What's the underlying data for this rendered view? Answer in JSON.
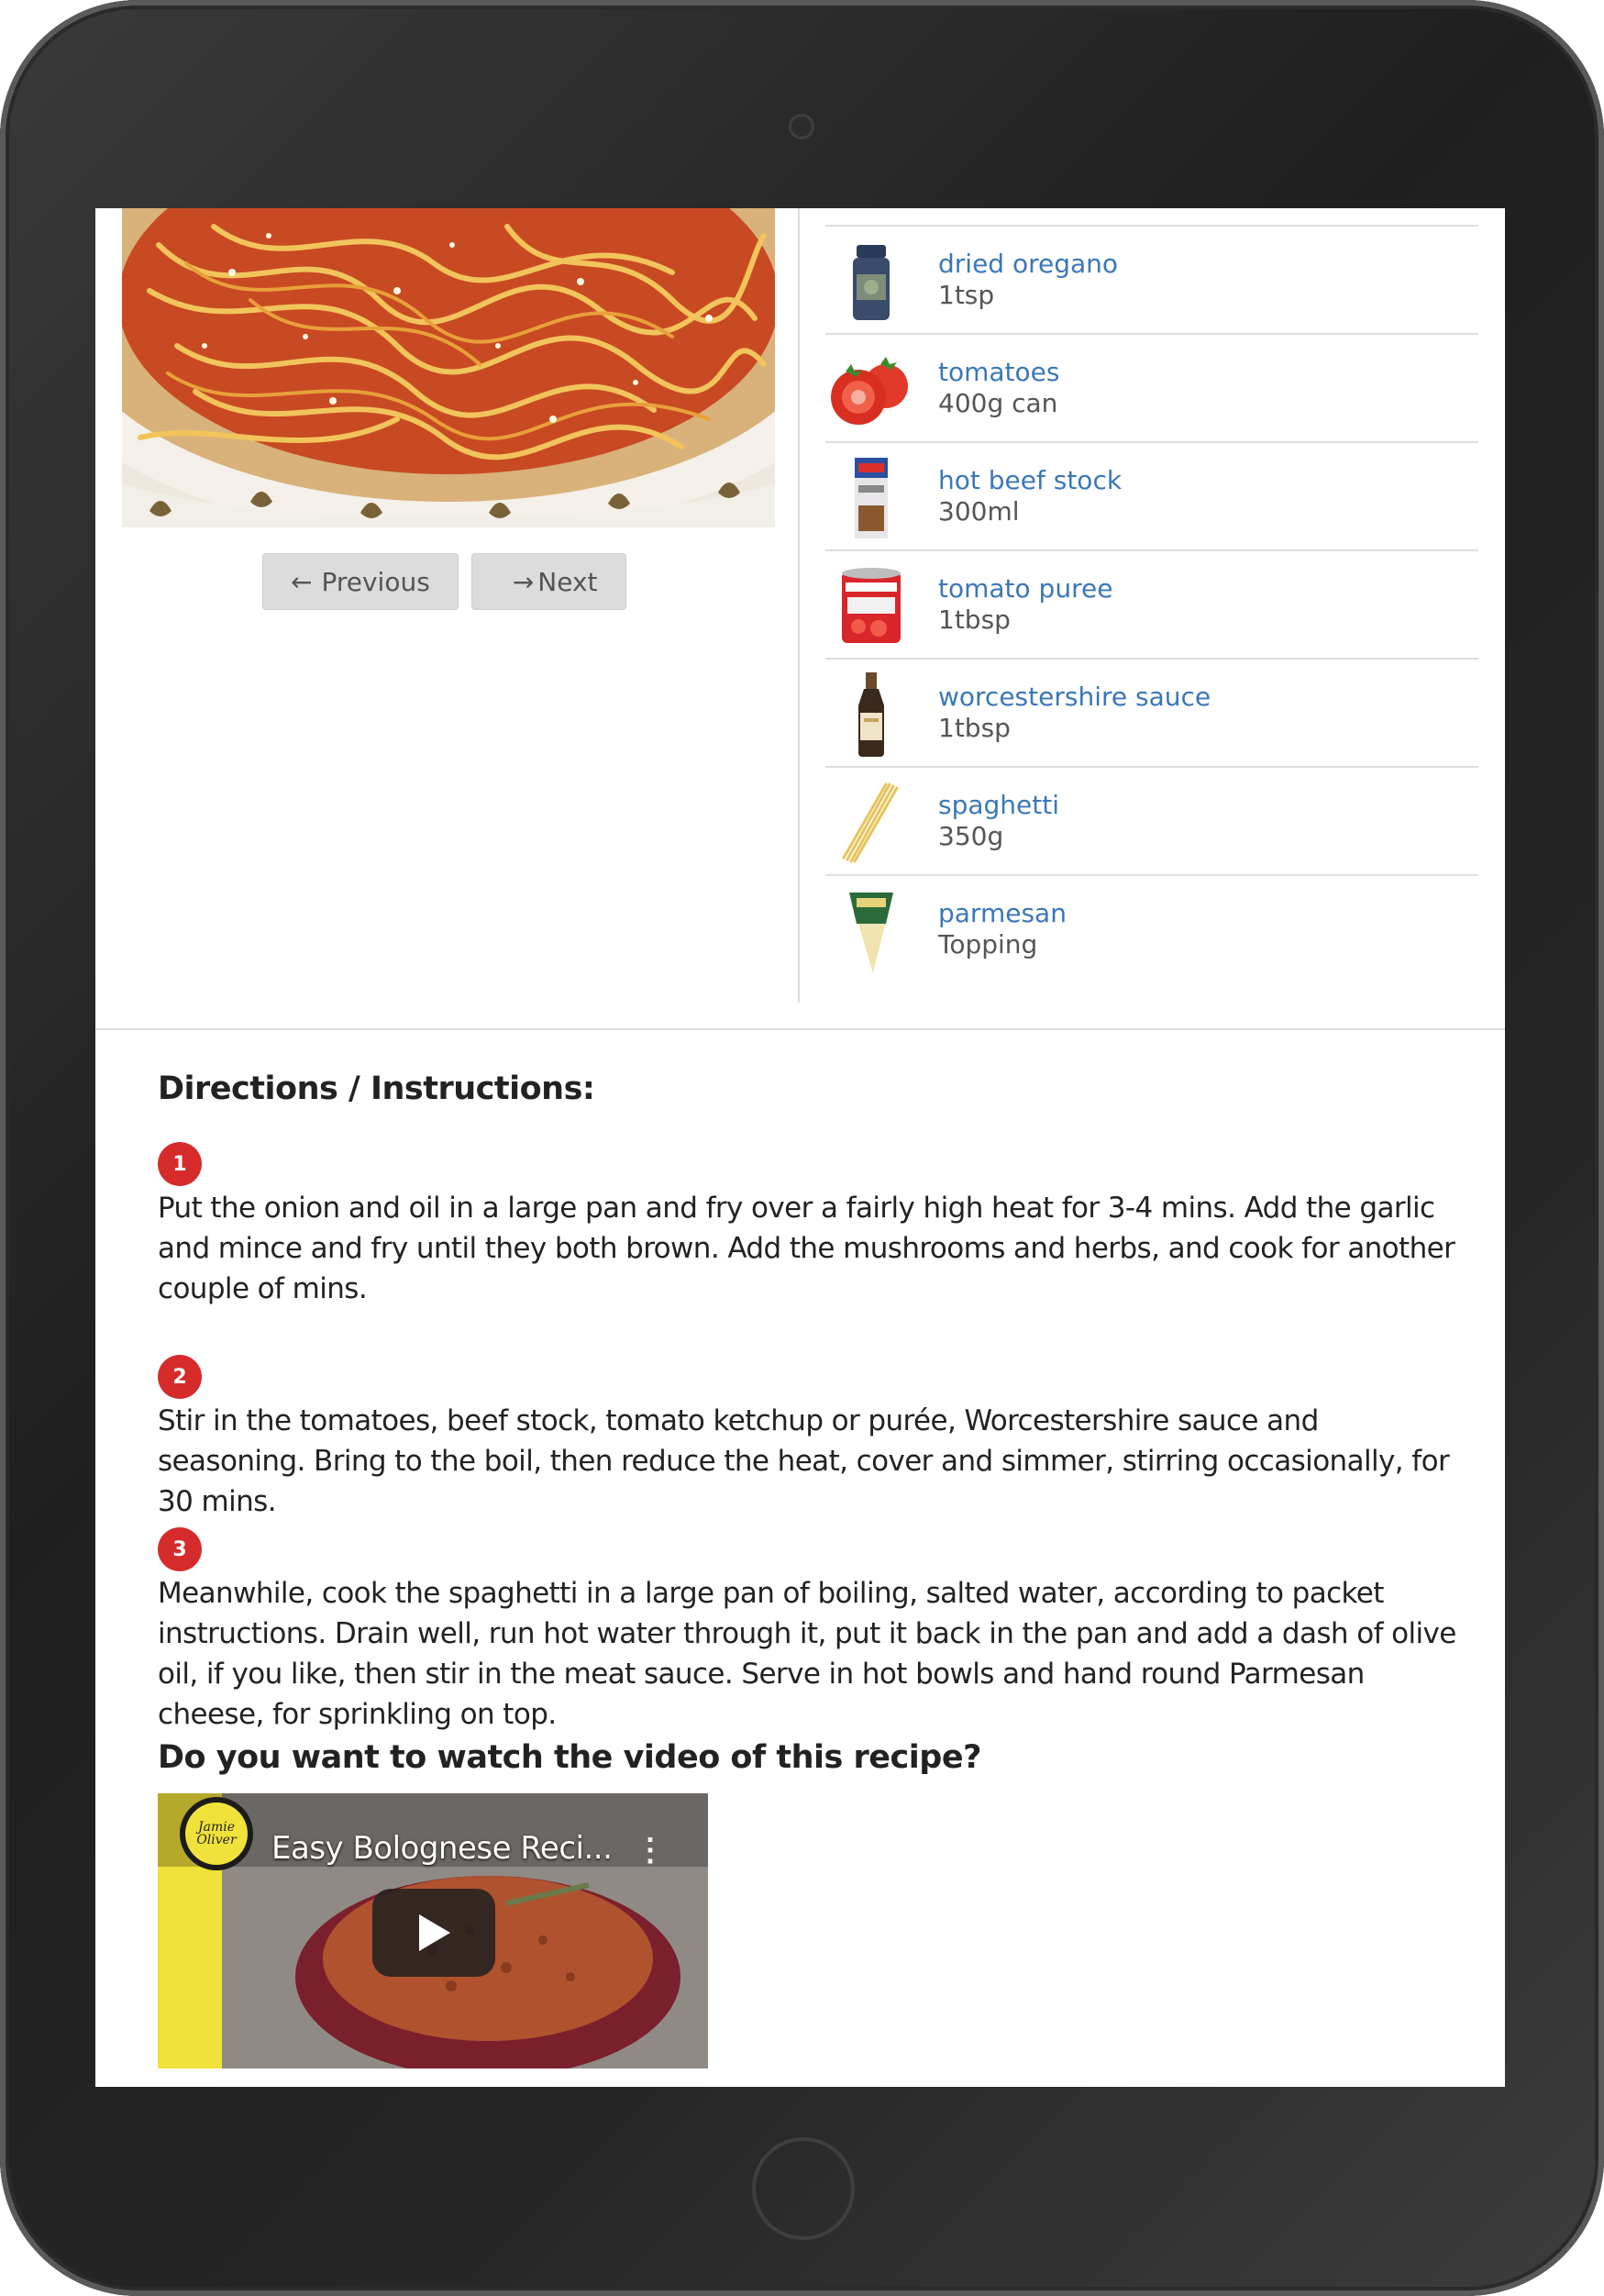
{
  "nav": {
    "previous_label": "Previous",
    "next_label": "Next",
    "previous_icon": "arrow-left-icon",
    "next_icon": "arrow-right-icon"
  },
  "ingredients": [
    {
      "name": "dried oregano",
      "quantity": "1tsp",
      "icon": "oregano-jar-icon"
    },
    {
      "name": "tomatoes",
      "quantity": "400g can",
      "icon": "tomato-icon"
    },
    {
      "name": "hot beef stock",
      "quantity": "300ml",
      "icon": "stock-carton-icon"
    },
    {
      "name": "tomato puree",
      "quantity": "1tbsp",
      "icon": "puree-can-icon"
    },
    {
      "name": "worcestershire sauce",
      "quantity": "1tbsp",
      "icon": "sauce-bottle-icon"
    },
    {
      "name": "spaghetti",
      "quantity": "350g",
      "icon": "spaghetti-icon"
    },
    {
      "name": "parmesan",
      "quantity": "Topping",
      "icon": "parmesan-icon"
    }
  ],
  "directions": {
    "title": "Directions / Instructions:",
    "steps": [
      {
        "number": "1",
        "text": "Put the onion and oil in a large pan and fry over a fairly high heat for 3-4 mins. Add the garlic and mince and fry until they both brown. Add the mushrooms and herbs, and cook for another couple of mins."
      },
      {
        "number": "2",
        "text": "Stir in the tomatoes, beef stock, tomato ketchup or purée, Worcestershire sauce and seasoning. Bring to the boil, then reduce the heat, cover and simmer, stirring occasionally, for 30 mins."
      },
      {
        "number": "3",
        "text": "Meanwhile, cook the spaghetti in a large pan of boiling, salted water, according to packet instructions. Drain well, run hot water through it, put it back in the pan and add a dash of olive oil, if you like, then stir in the meat sauce. Serve in hot bowls and hand round Parmesan cheese, for sprinkling on top."
      }
    ]
  },
  "video": {
    "question": "Do you want to watch the video of this recipe?",
    "title": "Easy Bolognese Reci...",
    "channel_logo_text": "Jamie Oliver"
  },
  "colors": {
    "link": "#3b77b8",
    "step_badge": "#d62b2b",
    "button_bg": "#dcdcdc"
  }
}
